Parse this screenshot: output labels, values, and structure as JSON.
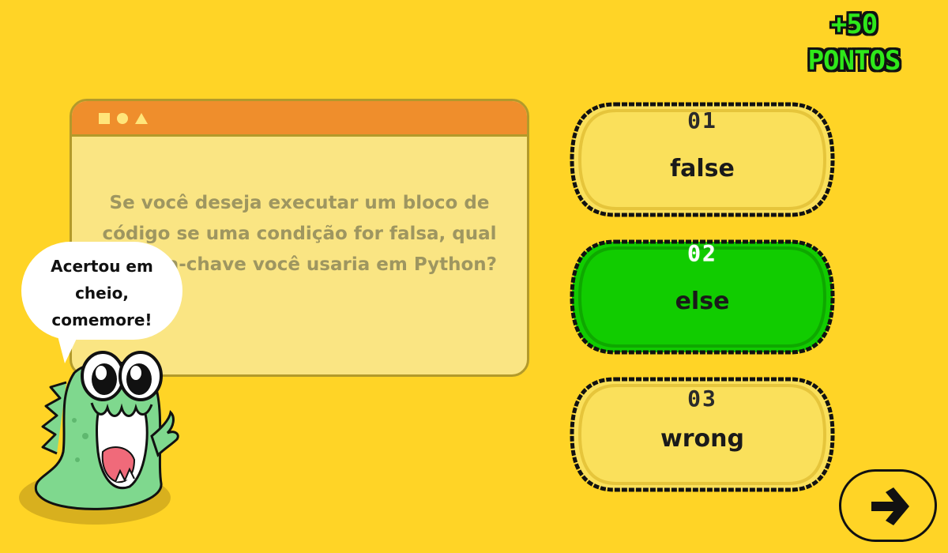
{
  "points": {
    "line1": "+50",
    "line2": "PONTOS"
  },
  "question": {
    "text": "Se você deseja executar um bloco de código se uma condição for falsa, qual palavra-chave você usaria em Python?"
  },
  "options": [
    {
      "number": "01",
      "label": "false",
      "state": "normal"
    },
    {
      "number": "02",
      "label": "else",
      "state": "correct"
    },
    {
      "number": "03",
      "label": "wrong",
      "state": "normal"
    }
  ],
  "mascot": {
    "speech": "Acertou em cheio, comemore!"
  },
  "colors": {
    "background": "#FFD426",
    "option_default": "#FAE05B",
    "option_correct": "#11CC00",
    "window_bar": "#EF8E2C",
    "points_text": "#2EE81A"
  },
  "icons": {
    "next": "arrow-right-icon"
  }
}
